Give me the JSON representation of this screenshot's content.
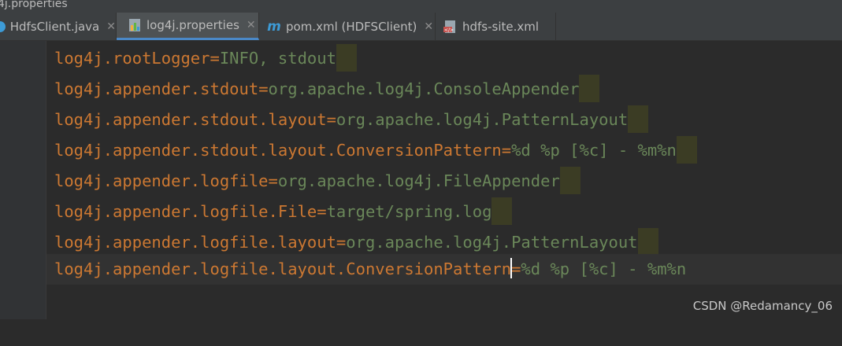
{
  "window": {
    "title": "4j.properties"
  },
  "tabs": [
    {
      "label": "HdfsClient.java",
      "icon": "java-class-icon",
      "closable": true,
      "active": false
    },
    {
      "label": "log4j.properties",
      "icon": "properties-file-icon",
      "closable": true,
      "active": true
    },
    {
      "label": "pom.xml (HDFSClient)",
      "icon": "maven-icon",
      "closable": true,
      "active": false
    },
    {
      "label": "hdfs-site.xml",
      "icon": "xml-file-icon",
      "closable": false,
      "active": false
    }
  ],
  "editor": {
    "lines": [
      {
        "key": "log4j.rootLogger",
        "sep": "=",
        "value": "INFO, stdout"
      },
      {
        "key": "log4j.appender.stdout",
        "sep": "=",
        "value": "org.apache.log4j.ConsoleAppender"
      },
      {
        "key": "log4j.appender.stdout.layout",
        "sep": "=",
        "value": "org.apache.log4j.PatternLayout"
      },
      {
        "key": "log4j.appender.stdout.layout.ConversionPattern",
        "sep": "=",
        "value": "%d %p [%c] - %m%n"
      },
      {
        "key": "log4j.appender.logfile",
        "sep": "=",
        "value": "org.apache.log4j.FileAppender"
      },
      {
        "key": "log4j.appender.logfile.File",
        "sep": "=",
        "value": "target/spring.log"
      },
      {
        "key": "log4j.appender.logfile.layout",
        "sep": "=",
        "value": "org.apache.log4j.PatternLayout"
      },
      {
        "key": "log4j.appender.logfile.layout.ConversionPattern",
        "sep": "=",
        "value": "%d %p [%c] - %m%n"
      }
    ],
    "current_line": 8
  },
  "watermark": "CSDN @Redamancy_06",
  "colors": {
    "key": "#cc7832",
    "value": "#6a8759",
    "trailing_highlight": "#3b3c24",
    "active_tab_underline": "#4a88c7"
  }
}
